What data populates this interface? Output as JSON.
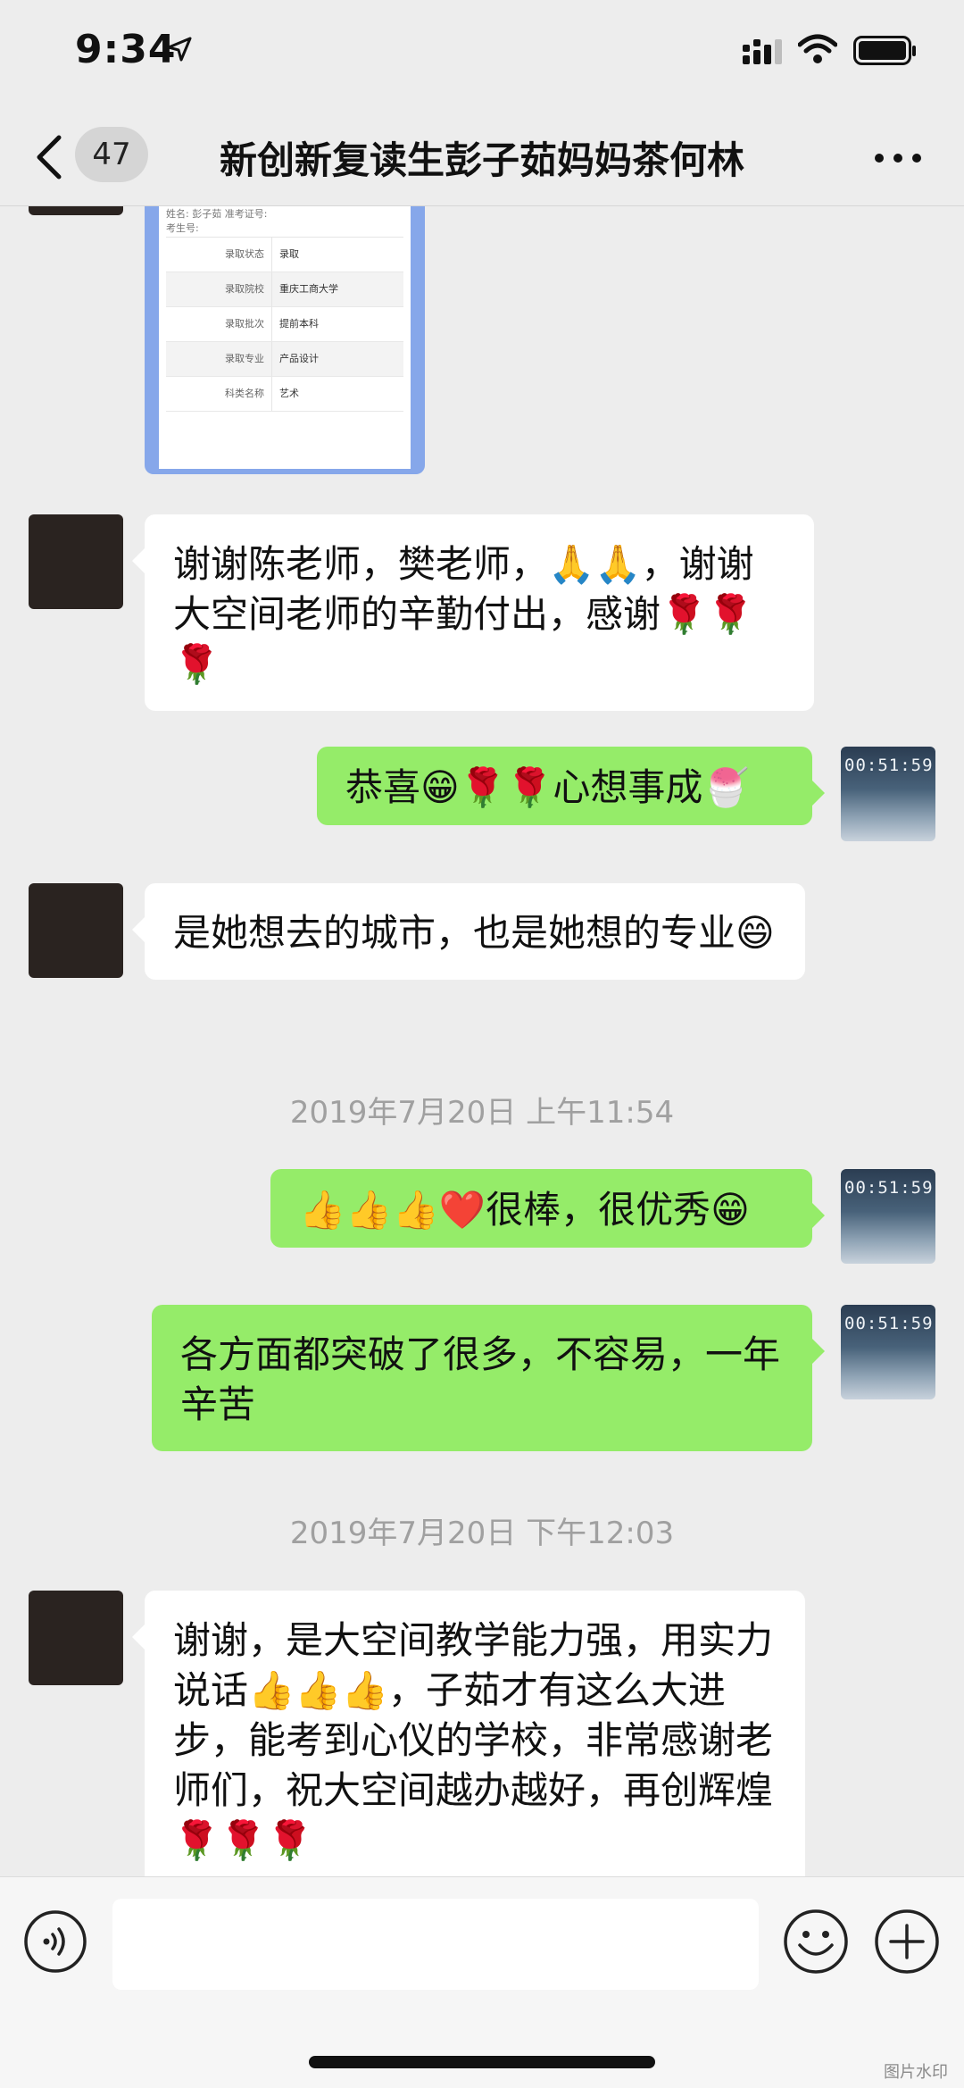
{
  "status_bar": {
    "time": "9:34"
  },
  "nav": {
    "badge": "47",
    "title": "新创新复读生彭子茹妈妈茶何林"
  },
  "admission_image": {
    "top_line1": "姓名: 彭子茹      准考证号: ",
    "top_line2": "考生号:",
    "rows": [
      {
        "k": "录取状态",
        "v": "录取"
      },
      {
        "k": "录取院校",
        "v": "重庆工商大学"
      },
      {
        "k": "录取批次",
        "v": "提前本科"
      },
      {
        "k": "录取专业",
        "v": "产品设计"
      },
      {
        "k": "科类名称",
        "v": "艺术"
      }
    ]
  },
  "messages": {
    "m1": "谢谢陈老师，樊老师，🙏🙏，谢谢大空间老师的辛勤付出，感谢🌹🌹🌹",
    "m2": "恭喜😁🌹🌹心想事成🍧",
    "m3": "是她想去的城市，也是她想的专业😄",
    "ts1": "2019年7月20日 上午11:54",
    "m4": "👍👍👍❤️很棒，很优秀😁",
    "m5": "各方面都突破了很多，不容易，一年辛苦",
    "ts2": "2019年7月20日 下午12:03",
    "m6": "谢谢，是大空间教学能力强，用实力说话👍👍👍，子茹才有这么大进步，能考到心仪的学校，非常感谢老师们，祝大空间越办越好，再创辉煌🌹🌹🌹"
  },
  "avatar_clock": "00:51:59",
  "footer": {
    "watermark": "图片水印"
  },
  "colors": {
    "outgoing_bubble": "#95ec69",
    "incoming_bubble": "#ffffff",
    "background": "#ededed"
  },
  "icons": [
    "location-arrow-icon",
    "signal-icon",
    "wifi-icon",
    "battery-icon",
    "back-chevron-icon",
    "more-icon",
    "voice-icon",
    "emoji-icon",
    "plus-icon"
  ]
}
